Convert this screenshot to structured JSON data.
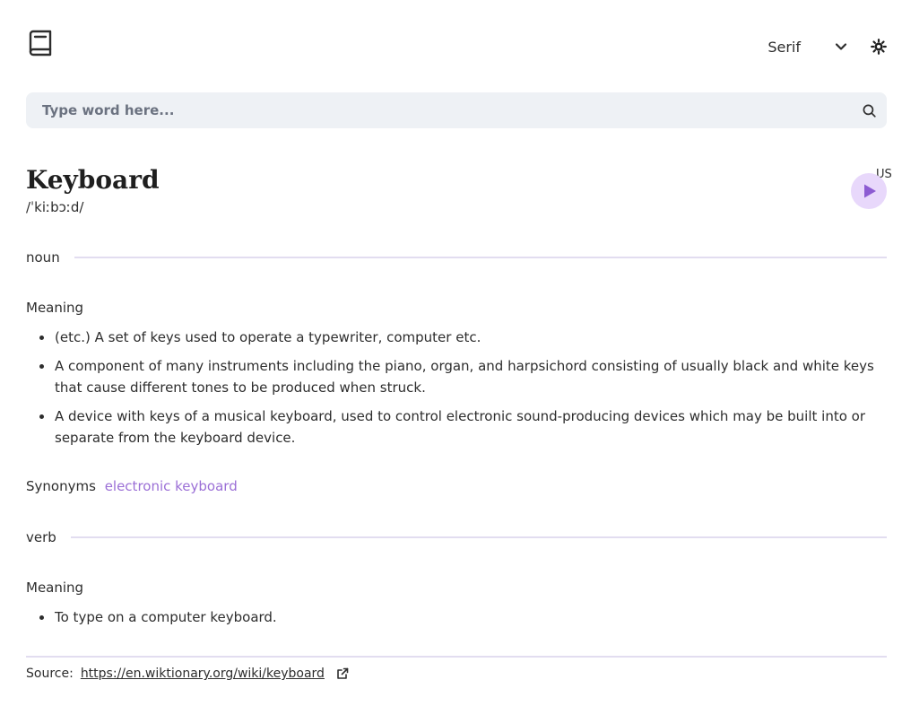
{
  "header": {
    "logo_icon": "book-icon",
    "font_select": {
      "value": "Serif",
      "icon": "chevron-down-icon"
    },
    "theme_toggle_icon": "sun-icon"
  },
  "search": {
    "placeholder": "Type word here...",
    "value": "",
    "icon": "search-icon"
  },
  "entry": {
    "word": "Keyboard",
    "phonetic": "/ˈkiːbɔːd/",
    "audio": {
      "label": "US",
      "icon": "play-icon"
    }
  },
  "meanings": [
    {
      "part_of_speech": "noun",
      "heading": "Meaning",
      "definitions": [
        "(etc.) A set of keys used to operate a typewriter, computer etc.",
        "A component of many instruments including the piano, organ, and harpsichord consisting of usually black and white keys that cause different tones to be produced when struck.",
        "A device with keys of a musical keyboard, used to control electronic sound-producing devices which may be built into or separate from the keyboard device."
      ],
      "synonyms_label": "Synonyms",
      "synonyms": [
        "electronic keyboard"
      ]
    },
    {
      "part_of_speech": "verb",
      "heading": "Meaning",
      "definitions": [
        "To type on a computer keyboard."
      ]
    }
  ],
  "source": {
    "label": "Source:",
    "url": "https://en.wiktionary.org/wiki/keyboard",
    "icon": "external-link-icon"
  },
  "colors": {
    "accent": "#9b6fd6",
    "play_bg": "#e8d8fb",
    "search_bg": "#eef1f5",
    "divider": "#e2ddf0"
  }
}
